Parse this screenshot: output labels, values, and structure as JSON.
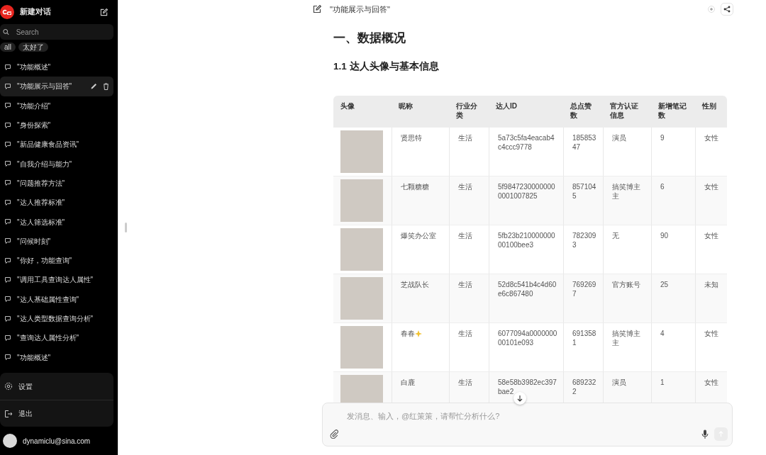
{
  "sidebar": {
    "app_name": "新建对话",
    "search": {
      "placeholder": "Search"
    },
    "filters": [
      {
        "label": "all"
      },
      {
        "label": "太好了"
      }
    ],
    "conversations": [
      {
        "title": "\"功能概述\"",
        "selected": false
      },
      {
        "title": "\"功能展示与回答\"",
        "selected": true
      },
      {
        "title": "\"功能介绍\"",
        "selected": false
      },
      {
        "title": "\"身份探索\"",
        "selected": false
      },
      {
        "title": "\"新品健康食品资讯\"",
        "selected": false
      },
      {
        "title": "\"自我介绍与能力\"",
        "selected": false
      },
      {
        "title": "\"问题推荐方法\"",
        "selected": false
      },
      {
        "title": "\"达人推荐标准\"",
        "selected": false
      },
      {
        "title": "\"达人筛选标准\"",
        "selected": false
      },
      {
        "title": "\"问候时刻\"",
        "selected": false
      },
      {
        "title": "\"你好，功能查询\"",
        "selected": false
      },
      {
        "title": "\"调用工具查询达人属性\"",
        "selected": false
      },
      {
        "title": "\"达人基础属性查询\"",
        "selected": false
      },
      {
        "title": "\"达人类型数据查询分析\"",
        "selected": false
      },
      {
        "title": "\"查询达人属性分析\"",
        "selected": false
      },
      {
        "title": "\"功能概述\"",
        "selected": false
      }
    ],
    "menu": [
      {
        "kind": "settings",
        "label": "设置"
      },
      {
        "kind": "logout",
        "label": "退出"
      }
    ],
    "user": {
      "email": "dynamiclu@sina.com"
    }
  },
  "conversation": {
    "title": "\"功能展示与回答\"",
    "heading": "一、数据概况",
    "subheading": "1.1 达人头像与基本信息",
    "table": {
      "columns": [
        "头像",
        "昵称",
        "行业分类",
        "达人ID",
        "总点赞数",
        "官方认证信息",
        "新增笔记数",
        "性别"
      ],
      "rows": [
        {
          "nickname": "贤思特",
          "emoji": false,
          "category": "生活",
          "id": "5a73c5fa4eacab4c4ccc9778",
          "likes": "18585347",
          "verification": "演员",
          "new_notes": "9",
          "gender": "女性"
        },
        {
          "nickname": "七颗糖糖",
          "emoji": false,
          "category": "生活",
          "id": "5f98472300000000001007825",
          "likes": "8571045",
          "verification": "搞笑博主主",
          "new_notes": "6",
          "gender": "女性"
        },
        {
          "nickname": "爆笑办公室",
          "emoji": false,
          "category": "生活",
          "id": "5fb23b21000000000100bee3",
          "likes": "7823093",
          "verification": "无",
          "new_notes": "90",
          "gender": "女性"
        },
        {
          "nickname": "芝战队长",
          "emoji": false,
          "category": "生活",
          "id": "52d8c541b4c4d60e6c867480",
          "likes": "7692697",
          "verification": "官方账号",
          "new_notes": "25",
          "gender": "未知"
        },
        {
          "nickname": "春春",
          "emoji": true,
          "category": "生活",
          "id": "6077094a000000000101e093",
          "likes": "6913581",
          "verification": "搞笑博主主",
          "new_notes": "4",
          "gender": "女性"
        },
        {
          "nickname": "白鹿",
          "emoji": false,
          "category": "生活",
          "id": "58e58b3982ec397bae2",
          "likes": "6892322",
          "verification": "演员",
          "new_notes": "1",
          "gender": "女性"
        }
      ]
    }
  },
  "composer": {
    "placeholder": "发消息、输入，@红策策，请帮忙分析什么?"
  }
}
